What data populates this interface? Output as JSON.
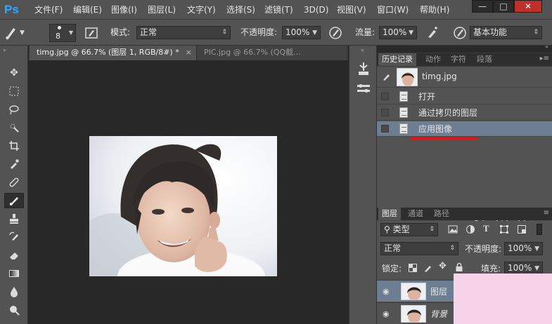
{
  "app": {
    "logo": "Ps"
  },
  "menu": [
    "文件(F)",
    "编辑(E)",
    "图像(I)",
    "图层(L)",
    "文字(Y)",
    "选择(S)",
    "滤镜(T)",
    "3D(D)",
    "视图(V)",
    "窗口(W)",
    "帮助(H)"
  ],
  "window_controls": {
    "minimize": "—",
    "maximize": "□",
    "close": "✕"
  },
  "options": {
    "brush_size": "8",
    "mode_label": "模式:",
    "mode_value": "正常",
    "opacity_label": "不透明度:",
    "opacity_value": "100%",
    "flow_label": "流量:",
    "flow_value": "100%",
    "workspace": "基本功能"
  },
  "tabs": [
    {
      "label": "timg.jpg @ 66.7% (图层 1, RGB/8#) *",
      "close": "×"
    },
    {
      "label": "PIC.jpg @ 66.7% (QQ截..."
    }
  ],
  "history_panel": {
    "tabs": [
      "历史记录",
      "动作",
      "字符",
      "段落"
    ],
    "snapshot": "timg.jpg",
    "items": [
      "打开",
      "通过拷贝的图层",
      "应用图像"
    ],
    "selected_index": 2
  },
  "layers_panel": {
    "tabs": [
      "图层",
      "通道",
      "路径"
    ],
    "filter_label": "类型",
    "blend_mode": "正常",
    "opacity_label": "不透明度:",
    "opacity_value": "100%",
    "lock_label": "锁定:",
    "fill_label": "填充:",
    "fill_value": "100%",
    "layers": [
      {
        "name": "图层"
      },
      {
        "name": "背景"
      }
    ]
  },
  "colors": {
    "accent": "#31a8ff",
    "selected_row": "#6d7e93",
    "annotation": "#e11515"
  }
}
